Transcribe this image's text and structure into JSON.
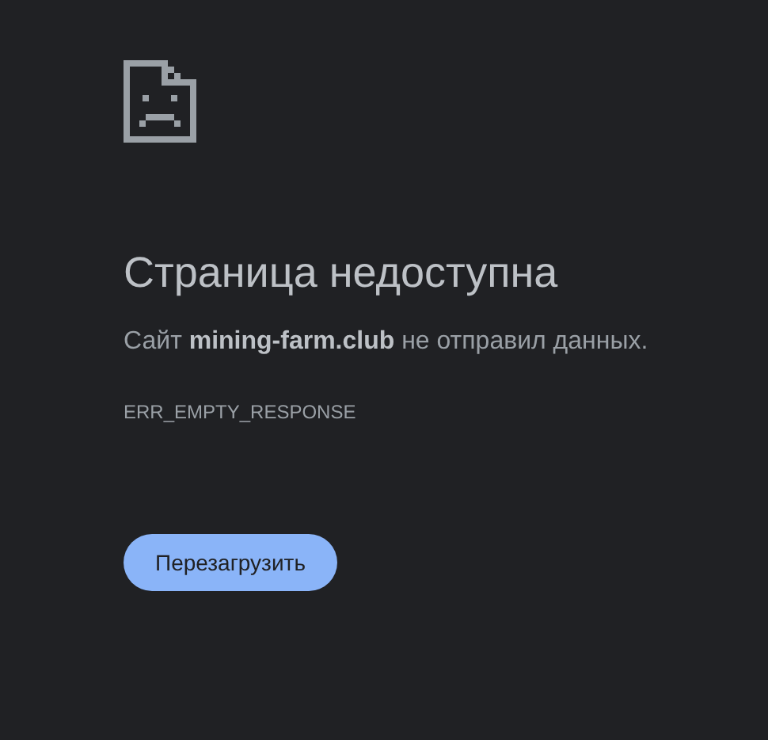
{
  "title": "Страница недоступна",
  "message": "Сайт **mining-farm.club** не отправил данных.",
  "error_code": "ERR_EMPTY_RESPONSE",
  "button": "Перезагрузить"
}
